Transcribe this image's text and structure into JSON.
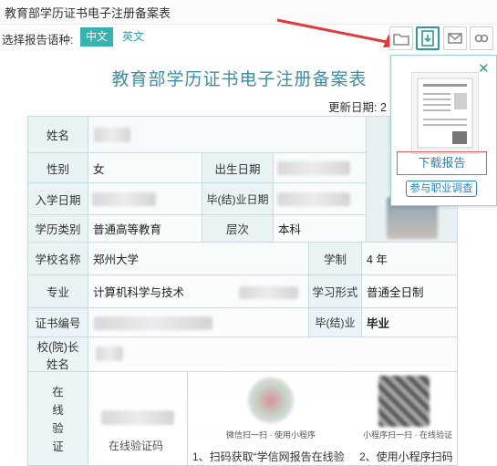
{
  "page_header": {
    "title": "教育部学历证书电子注册备案表"
  },
  "language_selector": {
    "label": "选择报告语种:",
    "zh": "中文",
    "en": "英文"
  },
  "toolbar": {
    "icons": [
      "folder-icon",
      "download-report-icon",
      "mail-icon",
      "link-icon"
    ]
  },
  "certificate": {
    "title": "教育部学历证书电子注册备案表",
    "update_date_label": "更新日期: 2",
    "labels": {
      "name": "姓名",
      "gender": "性别",
      "birth_date": "出生日期",
      "enroll_date": "入学日期",
      "grad_date": "毕(结)业日期",
      "edu_type": "学历类别",
      "level": "层次",
      "school": "学校名称",
      "duration": "学制",
      "major": "专业",
      "study_form": "学习形式",
      "cert_no": "证书编号",
      "grad_status": "毕(结)业",
      "president": "校(院)长姓名",
      "online_verify": "在线验证"
    },
    "values": {
      "gender": "女",
      "edu_type": "普通高等教育",
      "level": "本科",
      "school": "郑州大学",
      "duration": "4 年",
      "major": "计算机科学与技术",
      "study_form": "普通全日制",
      "grad_status": "毕业"
    },
    "verify": {
      "code_label": "在线验证码",
      "wechat_label": "微信扫一扫 · 使用小程序",
      "app_label": "小程序扫一扫 · 在线验证",
      "step1": "1、扫码获取“学信网报告在线验",
      "step2": "2、使用小程序扫码"
    }
  },
  "popup": {
    "download_label": "下载报告",
    "survey_label": "参与职业调查",
    "close": "✕"
  },
  "colors": {
    "accent": "#35b3b0",
    "arrow": "#e03a3a",
    "title": "#3a8fa3"
  }
}
